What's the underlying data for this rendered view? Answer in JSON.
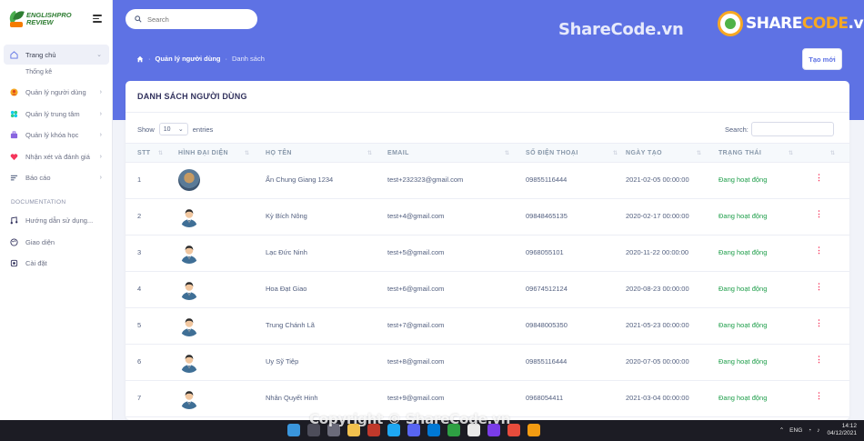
{
  "sidebar": {
    "logo": {
      "line1": "ENGLISHPRO",
      "line2": "REVIEW"
    },
    "items": [
      {
        "label": "Trang chủ",
        "icon": "home-icon",
        "active": true
      },
      {
        "label": "Quản lý người dùng",
        "icon": "user-icon"
      },
      {
        "label": "Quản lý trung tâm",
        "icon": "center-icon"
      },
      {
        "label": "Quản lý khóa học",
        "icon": "course-icon"
      },
      {
        "label": "Nhận xét và đánh giá",
        "icon": "heart-icon"
      },
      {
        "label": "Báo cáo",
        "icon": "report-icon"
      }
    ],
    "sub_item": "Thống kê",
    "section_title": "DOCUMENTATION",
    "doc_items": [
      {
        "label": "Hướng dẫn sử dụng...",
        "icon": "guide-icon"
      },
      {
        "label": "Giao diện",
        "icon": "palette-icon"
      },
      {
        "label": "Cài đặt",
        "icon": "settings-icon"
      }
    ]
  },
  "header": {
    "search_placeholder": "Search",
    "watermark": "ShareCode.vn",
    "brand_prefix": "SHARE",
    "brand_suffix": "CODE",
    "brand_tld": ".vn",
    "breadcrumb": [
      "Quản lý người dùng",
      "Danh sách"
    ],
    "new_button": "Tạo mới",
    "accent": "#5e72e4"
  },
  "card": {
    "title": "DANH SÁCH NGƯỜI DÙNG",
    "show_label": "Show",
    "page_size": "10",
    "entries_label": "entries",
    "search_label": "Search:"
  },
  "table": {
    "columns": [
      "STT",
      "HÌNH ĐẠI DIỆN",
      "HỌ TÊN",
      "EMAIL",
      "SỐ ĐIỆN THOẠI",
      "NGÀY TẠO",
      "TRẠNG THÁI"
    ],
    "rows": [
      {
        "stt": "1",
        "name": "Ẩn Chung Giang 1234",
        "email": "test+232323@gmail.com",
        "phone": "09855116444",
        "created": "2021-02-05 00:00:00",
        "status": "Đang hoạt động",
        "avatar": "photo"
      },
      {
        "stt": "2",
        "name": "Kỳ Bích Nông",
        "email": "test+4@gmail.com",
        "phone": "09848465135",
        "created": "2020-02-17 00:00:00",
        "status": "Đang hoạt động",
        "avatar": "default"
      },
      {
        "stt": "3",
        "name": "Lạc Đức Ninh",
        "email": "test+5@gmail.com",
        "phone": "0968055101",
        "created": "2020-11-22 00:00:00",
        "status": "Đang hoạt động",
        "avatar": "default"
      },
      {
        "stt": "4",
        "name": "Hoa Đạt Giao",
        "email": "test+6@gmail.com",
        "phone": "09674512124",
        "created": "2020-08-23 00:00:00",
        "status": "Đang hoạt động",
        "avatar": "default"
      },
      {
        "stt": "5",
        "name": "Trung Chánh Lã",
        "email": "test+7@gmail.com",
        "phone": "09848005350",
        "created": "2021-05-23 00:00:00",
        "status": "Đang hoạt động",
        "avatar": "default"
      },
      {
        "stt": "6",
        "name": "Uy Sỹ Tiệp",
        "email": "test+8@gmail.com",
        "phone": "09855116444",
        "created": "2020-07-05 00:00:00",
        "status": "Đang hoạt động",
        "avatar": "default"
      },
      {
        "stt": "7",
        "name": "Nhân Quyết Hinh",
        "email": "test+9@gmail.com",
        "phone": "0968054411",
        "created": "2021-03-04 00:00:00",
        "status": "Đang hoạt động",
        "avatar": "default"
      }
    ]
  },
  "footer_watermark": "Copyright © ShareCode.vn",
  "taskbar": {
    "lang": "ENG",
    "time": "14:12",
    "date": "04/12/2021"
  }
}
